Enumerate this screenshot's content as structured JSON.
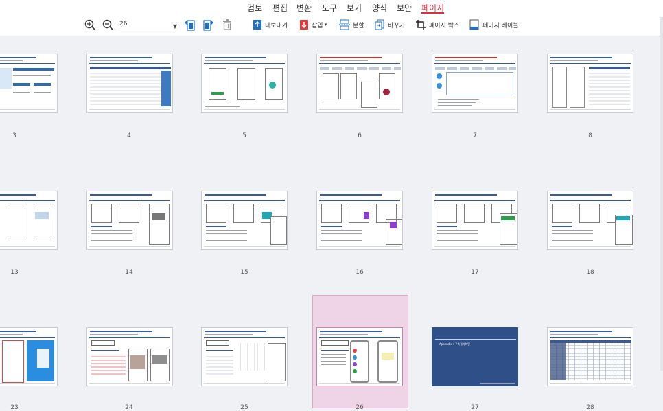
{
  "menu": {
    "items": [
      {
        "label": "검토"
      },
      {
        "label": "편집"
      },
      {
        "label": "변환"
      },
      {
        "label": "도구"
      },
      {
        "label": "보기"
      },
      {
        "label": "양식"
      },
      {
        "label": "보안"
      },
      {
        "label": "페이지",
        "active": true
      }
    ]
  },
  "toolbar": {
    "zoom_value": "26",
    "export_label": "내보내기",
    "insert_label": "삽입",
    "split_label": "분할",
    "replace_label": "바꾸기",
    "pagebox_label": "페이지 박스",
    "pagelabel_label": "페이지 레이블",
    "icons": [
      "zoom-in-icon",
      "zoom-out-icon",
      "rotate-left-icon",
      "rotate-right-icon",
      "delete-icon",
      "export-icon",
      "insert-icon",
      "split-icon",
      "replace-icon",
      "crop-icon",
      "page-label-icon"
    ]
  },
  "pages": {
    "row1": [
      "3",
      "4",
      "5",
      "6",
      "7",
      "8"
    ],
    "row2": [
      "13",
      "14",
      "15",
      "16",
      "17",
      "18"
    ],
    "row3": [
      "23",
      "24",
      "25",
      "26",
      "27",
      "28"
    ],
    "selected": "26"
  },
  "thumb27": {
    "title": "Appendix : 구축결과화면"
  },
  "colors": {
    "accent": "#e32c3b",
    "selection": "#efd3e7",
    "navy": "#3a598f"
  }
}
